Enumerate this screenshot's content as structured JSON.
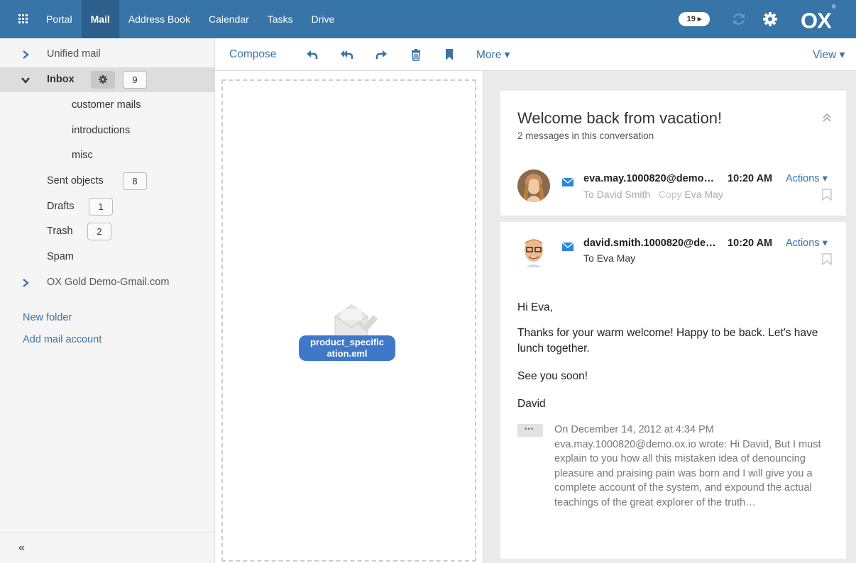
{
  "topbar": {
    "apps": [
      "Portal",
      "Mail",
      "Address Book",
      "Calendar",
      "Tasks",
      "Drive"
    ],
    "active_app": "Mail",
    "notification_count": "19 ▸",
    "logo": "OX"
  },
  "sidebar": {
    "unified_mail": "Unified mail",
    "inbox": {
      "label": "Inbox",
      "count": "9"
    },
    "subfolders": [
      "customer mails",
      "introductions",
      "misc"
    ],
    "sent": {
      "label": "Sent objects",
      "count": "8"
    },
    "drafts": {
      "label": "Drafts",
      "count": "1"
    },
    "trash": {
      "label": "Trash",
      "count": "2"
    },
    "spam": {
      "label": "Spam"
    },
    "external_account": "OX Gold Demo-Gmail.com",
    "new_folder": "New folder",
    "add_mail_account": "Add mail account",
    "collapse": "«"
  },
  "toolbar": {
    "compose": "Compose",
    "more": "More ▾",
    "view": "View ▾"
  },
  "dragged_file": {
    "name": "product_specification.eml",
    "line1": "product_specific",
    "line2": "ation.eml"
  },
  "thread": {
    "title": "Welcome back from vacation!",
    "subtitle": "2 messages in this conversation",
    "messages": [
      {
        "from": "eva.may.1000820@demo…",
        "time": "10:20 AM",
        "actions": "Actions ▾",
        "to_label": "To",
        "to": "David Smith",
        "copy_label": "Copy",
        "copy": "Eva May"
      },
      {
        "from": "david.smith.1000820@de…",
        "time": "10:20 AM",
        "actions": "Actions ▾",
        "to_label": "To",
        "to": "Eva May",
        "body": [
          "Hi Eva,",
          "Thanks for your warm welcome! Happy to be back. Let's have lunch together.",
          "See you soon!",
          "David"
        ],
        "quote_toggle": "•••",
        "quote": "On December 14, 2012 at 4:34 PM eva.may.1000820@demo.ox.io wrote: Hi David, But I must explain to you how all this mistaken idea of denouncing pleasure and praising pain was born and I will give you a complete account of the system, and expound the actual teachings of the great explorer of the truth…"
      }
    ]
  },
  "colors": {
    "topbar": "#3774a8",
    "topbar_active": "#2c5f8c",
    "link": "#3774a8",
    "envelope": "#2a88d8"
  }
}
